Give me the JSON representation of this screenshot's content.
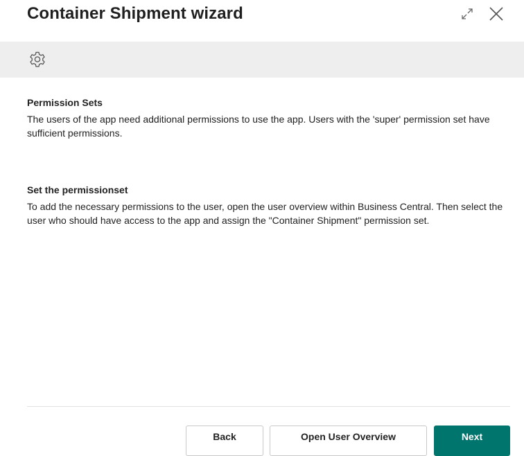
{
  "dialog": {
    "title": "Container Shipment wizard",
    "actions": {
      "expand_icon": "expand-icon",
      "close_icon": "close-icon"
    }
  },
  "banner": {
    "icon": "gear-icon",
    "background": "#eeeeee"
  },
  "sections": [
    {
      "heading": "Permission Sets",
      "text": "The users of the app need additional permissions to use the app. Users with the 'super' permission set have sufficient permissions."
    },
    {
      "heading": "Set the permissionset",
      "text": "To add the necessary permissions to the user, open the user overview within Business Central. Then select the user who should have access to the app and assign the \"Container Shipment\" permission set."
    }
  ],
  "footer": {
    "back_label": "Back",
    "open_user_overview_label": "Open User Overview",
    "next_label": "Next"
  },
  "colors": {
    "accent": "#00756e",
    "text": "#212121"
  }
}
